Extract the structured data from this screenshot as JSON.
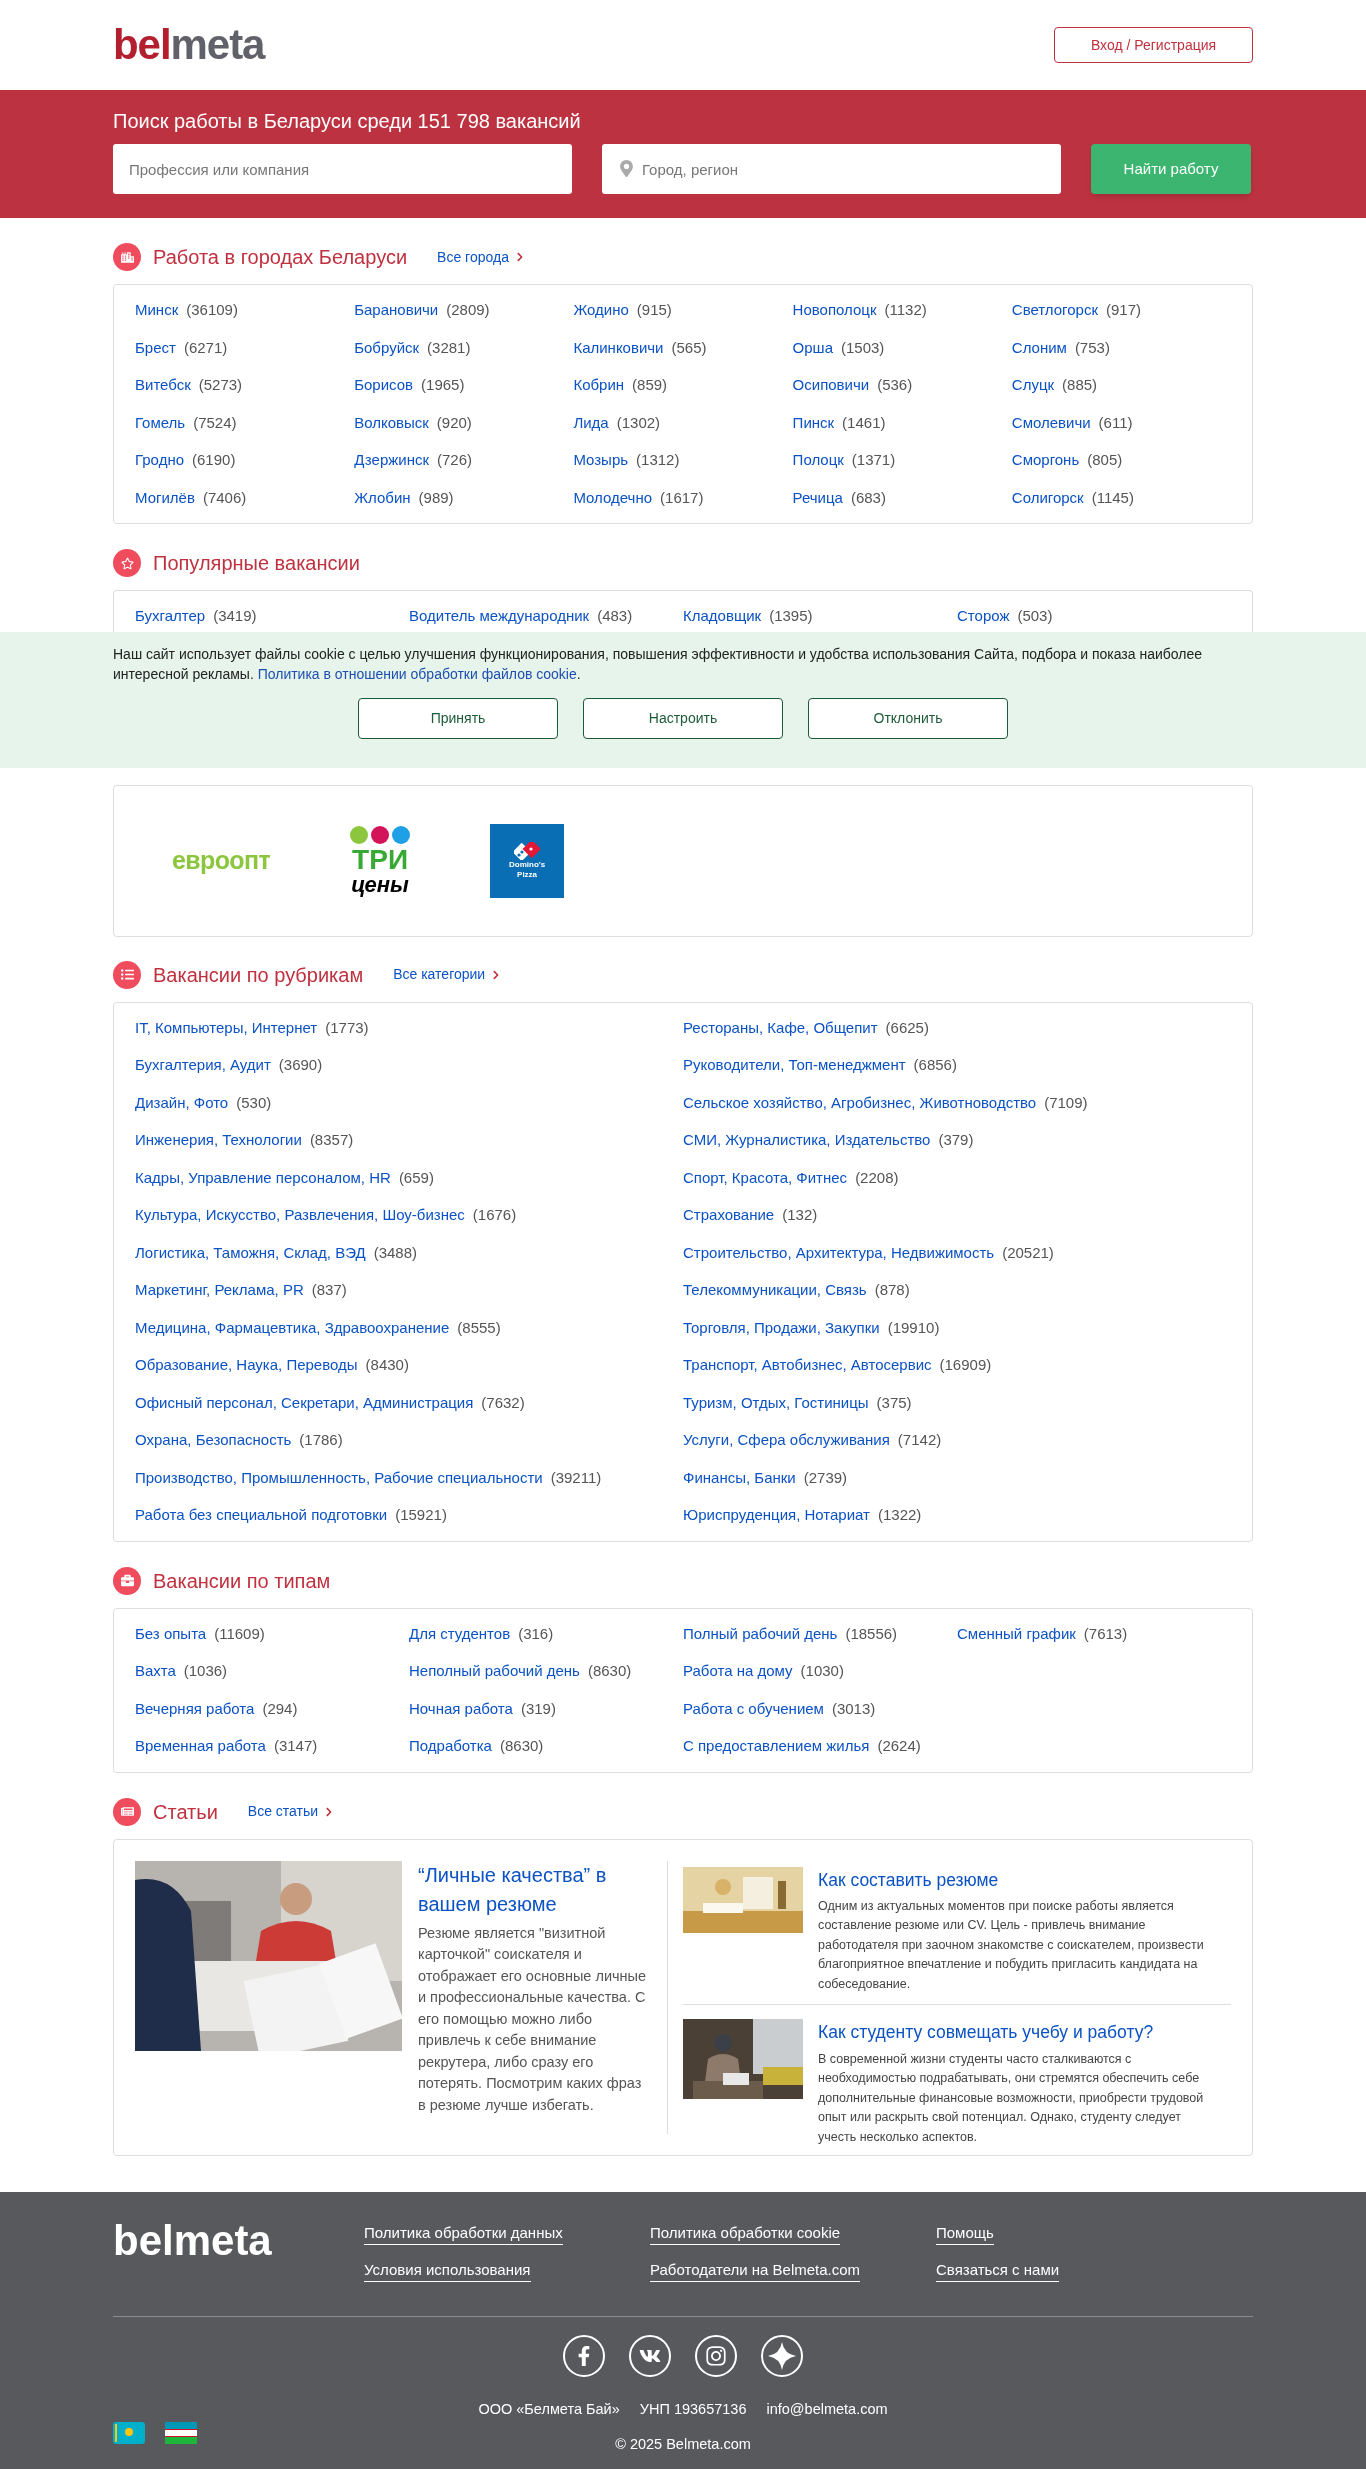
{
  "header": {
    "logo": {
      "accent": "bel",
      "rest": "meta"
    },
    "login_button": "Вход / Регистрация"
  },
  "search": {
    "title": "Поиск работы в Беларуси среди 151 798 вакансий",
    "query_placeholder": "Профессия или компания",
    "location_placeholder": "Город, регион",
    "button": "Найти работу"
  },
  "cities": {
    "title": "Работа в городах Беларуси",
    "more_link": "Все города",
    "items": [
      {
        "name": "Минск",
        "count": "(36109)"
      },
      {
        "name": "Брест",
        "count": "(6271)"
      },
      {
        "name": "Витебск",
        "count": "(5273)"
      },
      {
        "name": "Гомель",
        "count": "(7524)"
      },
      {
        "name": "Гродно",
        "count": "(6190)"
      },
      {
        "name": "Могилёв",
        "count": "(7406)"
      },
      {
        "name": "Барановичи",
        "count": "(2809)"
      },
      {
        "name": "Бобруйск",
        "count": "(3281)"
      },
      {
        "name": "Борисов",
        "count": "(1965)"
      },
      {
        "name": "Волковыск",
        "count": "(920)"
      },
      {
        "name": "Дзержинск",
        "count": "(726)"
      },
      {
        "name": "Жлобин",
        "count": "(989)"
      },
      {
        "name": "Жодино",
        "count": "(915)"
      },
      {
        "name": "Калинковичи",
        "count": "(565)"
      },
      {
        "name": "Кобрин",
        "count": "(859)"
      },
      {
        "name": "Лида",
        "count": "(1302)"
      },
      {
        "name": "Мозырь",
        "count": "(1312)"
      },
      {
        "name": "Молодечно",
        "count": "(1617)"
      },
      {
        "name": "Новополоцк",
        "count": "(1132)"
      },
      {
        "name": "Орша",
        "count": "(1503)"
      },
      {
        "name": "Осиповичи",
        "count": "(536)"
      },
      {
        "name": "Пинск",
        "count": "(1461)"
      },
      {
        "name": "Полоцк",
        "count": "(1371)"
      },
      {
        "name": "Речица",
        "count": "(683)"
      },
      {
        "name": "Светлогорск",
        "count": "(917)"
      },
      {
        "name": "Слоним",
        "count": "(753)"
      },
      {
        "name": "Слуцк",
        "count": "(885)"
      },
      {
        "name": "Смолевичи",
        "count": "(611)"
      },
      {
        "name": "Сморгонь",
        "count": "(805)"
      },
      {
        "name": "Солигорск",
        "count": "(1145)"
      }
    ]
  },
  "popular": {
    "title": "Популярные вакансии",
    "items": [
      {
        "name": "Бухгалтер",
        "count": "(3419)"
      },
      {
        "name": "Водитель международник",
        "count": "(483)"
      },
      {
        "name": "Кладовщик",
        "count": "(1395)"
      },
      {
        "name": "Сторож",
        "count": "(503)"
      }
    ]
  },
  "cookie_banner": {
    "text": "Наш сайт использует файлы cookie с целью улучшения функционирования, повышения эффективности и удобства использования Сайта, подбора и показа наиболее интересной рекламы.",
    "link": "Политика в отношении обработки файлов cookie",
    "link_suffix": ".",
    "buttons": [
      "Принять",
      "Настроить",
      "Отклонить"
    ]
  },
  "companies": [
    {
      "kind": "evroopt",
      "text": "евроопт"
    },
    {
      "kind": "tri",
      "top": "ТРИ",
      "bottom": "цены"
    },
    {
      "kind": "dominos",
      "top": "Domino's",
      "bottom": "Pizza"
    }
  ],
  "categories": {
    "title": "Вакансии по рубрикам",
    "more_link": "Все категории",
    "items": [
      {
        "name": "IT, Компьютеры, Интернет",
        "count": "(1773)"
      },
      {
        "name": "Бухгалтерия, Аудит",
        "count": "(3690)"
      },
      {
        "name": "Дизайн, Фото",
        "count": "(530)"
      },
      {
        "name": "Инженерия, Технологии",
        "count": "(8357)"
      },
      {
        "name": "Кадры, Управление персоналом, HR",
        "count": "(659)"
      },
      {
        "name": "Культура, Искусство, Развлечения, Шоу-бизнес",
        "count": "(1676)"
      },
      {
        "name": "Логистика, Таможня, Склад, ВЭД",
        "count": "(3488)"
      },
      {
        "name": "Маркетинг, Реклама, PR",
        "count": "(837)"
      },
      {
        "name": "Медицина, Фармацевтика, Здравоохранение",
        "count": "(8555)"
      },
      {
        "name": "Образование, Наука, Переводы",
        "count": "(8430)"
      },
      {
        "name": "Офисный персонал, Секретари, Администрация",
        "count": "(7632)"
      },
      {
        "name": "Охрана, Безопасность",
        "count": "(1786)"
      },
      {
        "name": "Производство, Промышленность, Рабочие специальности",
        "count": "(39211)"
      },
      {
        "name": "Работа без специальной подготовки",
        "count": "(15921)"
      },
      {
        "name": "Рестораны, Кафе, Общепит",
        "count": "(6625)"
      },
      {
        "name": "Руководители, Топ-менеджмент",
        "count": "(6856)"
      },
      {
        "name": "Сельское хозяйство, Агробизнес, Животноводство",
        "count": "(7109)"
      },
      {
        "name": "СМИ, Журналистика, Издательство",
        "count": "(379)"
      },
      {
        "name": "Спорт, Красота, Фитнес",
        "count": "(2208)"
      },
      {
        "name": "Страхование",
        "count": "(132)"
      },
      {
        "name": "Строительство, Архитектура, Недвижимость",
        "count": "(20521)"
      },
      {
        "name": "Телекоммуникации, Связь",
        "count": "(878)"
      },
      {
        "name": "Торговля, Продажи, Закупки",
        "count": "(19910)"
      },
      {
        "name": "Транспорт, Автобизнес, Автосервис",
        "count": "(16909)"
      },
      {
        "name": "Туризм, Отдых, Гостиницы",
        "count": "(375)"
      },
      {
        "name": "Услуги, Сфера обслуживания",
        "count": "(7142)"
      },
      {
        "name": "Финансы, Банки",
        "count": "(2739)"
      },
      {
        "name": "Юриспруденция, Нотариат",
        "count": "(1322)"
      }
    ]
  },
  "types": {
    "title": "Вакансии по типам",
    "columns": [
      [
        {
          "name": "Без опыта",
          "count": "(11609)"
        },
        {
          "name": "Вахта",
          "count": "(1036)"
        },
        {
          "name": "Вечерняя работа",
          "count": "(294)"
        },
        {
          "name": "Временная работа",
          "count": "(3147)"
        }
      ],
      [
        {
          "name": "Для студентов",
          "count": "(316)"
        },
        {
          "name": "Неполный рабочий день",
          "count": "(8630)"
        },
        {
          "name": "Ночная работа",
          "count": "(319)"
        },
        {
          "name": "Подработка",
          "count": "(8630)"
        }
      ],
      [
        {
          "name": "Полный рабочий день",
          "count": "(18556)"
        },
        {
          "name": "Работа на дому",
          "count": "(1030)"
        },
        {
          "name": "Работа с обучением",
          "count": "(3013)"
        },
        {
          "name": "С предоставлением жилья",
          "count": "(2624)"
        }
      ],
      [
        {
          "name": "Сменный график",
          "count": "(7613)"
        }
      ]
    ]
  },
  "articles": {
    "title": "Статьи",
    "more_link": "Все статьи",
    "featured": {
      "title": "“Личные качества” в вашем резюме",
      "text": "Резюме является \"визитной карточкой\" соискателя и отображает его основные личные и профессиональные качества. С его помощью можно либо привлечь к себе внимание рекрутера, либо сразу его потерять. Посмотрим каких фраз в резюме лучше избегать."
    },
    "items": [
      {
        "title": "Как составить резюме",
        "text": "Одним из актуальных моментов при поиске работы является составление резюме или CV. Цель - привлечь внимание работодателя при заочном знакомстве с соискателем, произвести благоприятное впечатление и побудить пригласить кандидата на собеседование."
      },
      {
        "title": "Как студенту совмещать учебу и работу?",
        "text": "В современной жизни студенты часто сталкиваются с необходимостью подрабатывать, они стремятся обеспечить себе дополнительные финансовые возможности, приобрести трудовой опыт или раскрыть свой потенциал. Однако, студенту следует учесть несколько аспектов."
      }
    ]
  },
  "footer": {
    "logo": "belmeta",
    "links": [
      [
        "Политика обработки данных",
        "Условия использования"
      ],
      [
        "Политика обработки cookie",
        "Работодатели на Belmeta.com"
      ],
      [
        "Помощь",
        "Связаться с нами"
      ]
    ],
    "company": "ООО «Белмета Бай»",
    "unp": "УНП 193657136",
    "email": "info@belmeta.com",
    "copyright": "© 2025 Belmeta.com"
  }
}
